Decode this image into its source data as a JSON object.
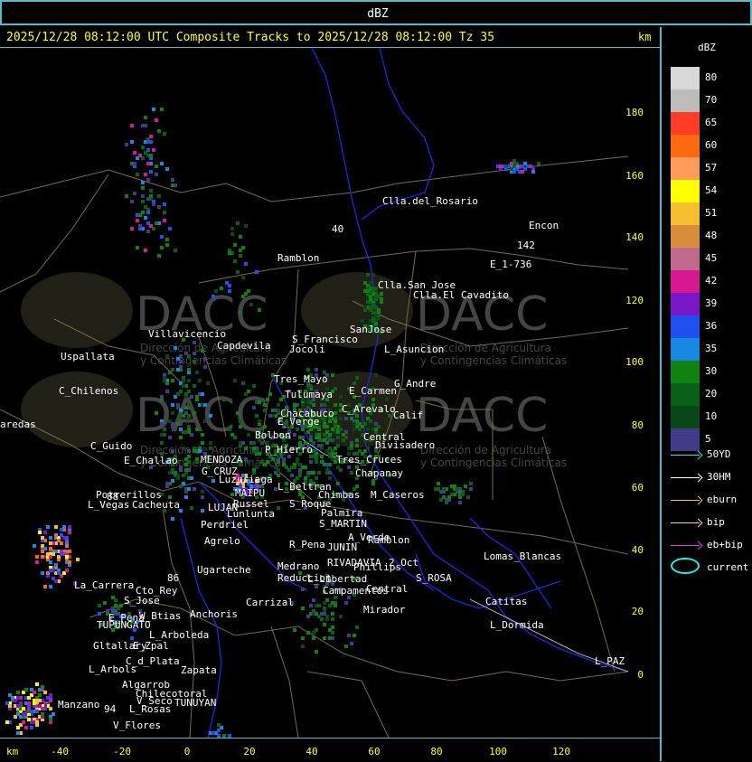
{
  "topbar": {
    "title": "dBZ"
  },
  "header": {
    "text": "2025/12/28 08:12:00 UTC Composite Tracks to 2025/12/28 08:12:00 Tz 35",
    "km_label": "km"
  },
  "axes": {
    "x_label": "km",
    "x_ticks": [
      "-40",
      "-20",
      "0",
      "20",
      "40",
      "60",
      "80",
      "100",
      "120"
    ],
    "y_ticks": [
      "180",
      "160",
      "140",
      "120",
      "100",
      "80",
      "60",
      "40",
      "20",
      "0"
    ]
  },
  "watermark": {
    "brand": "DACC",
    "line1": "Dirección de Agricultura",
    "line2": "y Contingencias Climáticas"
  },
  "places": [
    {
      "name": "Clla.del_Rosario"
    },
    {
      "name": "Encon"
    },
    {
      "name": "142"
    },
    {
      "name": "E_1-736"
    },
    {
      "name": "Ramblon"
    },
    {
      "name": "Clla.San Jose"
    },
    {
      "name": "Clla.El Cavadito"
    },
    {
      "name": "Villavicencio"
    },
    {
      "name": "Capdevila"
    },
    {
      "name": "S_Francisco"
    },
    {
      "name": "Jocoli"
    },
    {
      "name": "SanJose"
    },
    {
      "name": "L_Asuncion"
    },
    {
      "name": "Uspallata"
    },
    {
      "name": "C_Chilenos"
    },
    {
      "name": "Tres_Mayo"
    },
    {
      "name": "G_Andre"
    },
    {
      "name": "Tulumaya"
    },
    {
      "name": "E_Carmen"
    },
    {
      "name": "Chacabuco"
    },
    {
      "name": "C_Arevalo"
    },
    {
      "name": "E_Verge"
    },
    {
      "name": "Calif"
    },
    {
      "name": "aredas"
    },
    {
      "name": "Divisadero"
    },
    {
      "name": "Bolbon"
    },
    {
      "name": "Tres_Cruces"
    },
    {
      "name": "Central"
    },
    {
      "name": "C_Guido"
    },
    {
      "name": "P_Hierro"
    },
    {
      "name": "E_Challao"
    },
    {
      "name": "MENDOZA"
    },
    {
      "name": "G_CRUZ"
    },
    {
      "name": "Chapanay"
    },
    {
      "name": "Luzuriaga"
    },
    {
      "name": "L_Beltran"
    },
    {
      "name": "Potrerillos"
    },
    {
      "name": "MAIPU"
    },
    {
      "name": "Chimbas"
    },
    {
      "name": "M_Caseros"
    },
    {
      "name": "Russel"
    },
    {
      "name": "L_Vegas"
    },
    {
      "name": "Cacheuta"
    },
    {
      "name": "LUJAN"
    },
    {
      "name": "S_Roque"
    },
    {
      "name": "Lunlunta"
    },
    {
      "name": "Palmira"
    },
    {
      "name": "Perdriel"
    },
    {
      "name": "S_MARTIN"
    },
    {
      "name": "A_Verde"
    },
    {
      "name": "Agrelo"
    },
    {
      "name": "Ramblon"
    },
    {
      "name": "JUNIN"
    },
    {
      "name": "R_Pena"
    },
    {
      "name": "Lomas_Blancas"
    },
    {
      "name": "Ugarteche"
    },
    {
      "name": "RIVADAVIA"
    },
    {
      "name": "2_Oct"
    },
    {
      "name": "Phillips"
    },
    {
      "name": "Medrano"
    },
    {
      "name": "S_ROSA"
    },
    {
      "name": "Reduccion"
    },
    {
      "name": "L_Libertad"
    },
    {
      "name": "La_Carrera"
    },
    {
      "name": "Cto_Rey"
    },
    {
      "name": "Catitas"
    },
    {
      "name": "S_Jose"
    },
    {
      "name": "Campamentos"
    },
    {
      "name": "Carrizal"
    },
    {
      "name": "Central"
    },
    {
      "name": "Anchoris"
    },
    {
      "name": "W_Btias"
    },
    {
      "name": "E_Pena"
    },
    {
      "name": "Mirador"
    },
    {
      "name": "TUPUNGATO"
    },
    {
      "name": "L_Dormida"
    },
    {
      "name": "L_Arboleda"
    },
    {
      "name": "Gltallary"
    },
    {
      "name": "E_Zpal"
    },
    {
      "name": "C_d_Plata"
    },
    {
      "name": "L_PAZ"
    },
    {
      "name": "L_Arbols"
    },
    {
      "name": "Zapata"
    },
    {
      "name": "Algarrob"
    },
    {
      "name": "Chilecotoral"
    },
    {
      "name": "V_Seco"
    },
    {
      "name": "TUNUYAN"
    },
    {
      "name": "Manzano"
    },
    {
      "name": "94"
    },
    {
      "name": "L_Rosas"
    },
    {
      "name": "V_Flores"
    },
    {
      "name": "88"
    },
    {
      "name": "86"
    },
    {
      "name": "40"
    }
  ],
  "scale": {
    "title": "dBZ",
    "levels": [
      {
        "label": "80",
        "color": "#d8d8d8"
      },
      {
        "label": "70",
        "color": "#bcbcbc"
      },
      {
        "label": "65",
        "color": "#ff3c28"
      },
      {
        "label": "60",
        "color": "#ff6a10"
      },
      {
        "label": "57",
        "color": "#ff9c5a"
      },
      {
        "label": "54",
        "color": "#ffff00"
      },
      {
        "label": "51",
        "color": "#f5c030"
      },
      {
        "label": "48",
        "color": "#d88c3c"
      },
      {
        "label": "45",
        "color": "#c06a8c"
      },
      {
        "label": "42",
        "color": "#d81890"
      },
      {
        "label": "39",
        "color": "#7a18c8"
      },
      {
        "label": "36",
        "color": "#2050f0"
      },
      {
        "label": "35",
        "color": "#1888e0"
      },
      {
        "label": "30",
        "color": "#108010"
      },
      {
        "label": "20",
        "color": "#0a6018"
      },
      {
        "label": "10",
        "color": "#084818"
      },
      {
        "label": "5",
        "color": "#403c88"
      }
    ]
  },
  "legend": [
    {
      "label": "50YD",
      "color": "#2ee6e6"
    },
    {
      "label": "30HM",
      "color": "#ffffff"
    },
    {
      "label": "eburn",
      "color": "#f0c060"
    },
    {
      "label": "bip",
      "color": "#ffc8dc"
    },
    {
      "label": "eb+bip",
      "color": "#e040e0"
    },
    {
      "label": "current",
      "color": "#2ee6e6"
    }
  ]
}
